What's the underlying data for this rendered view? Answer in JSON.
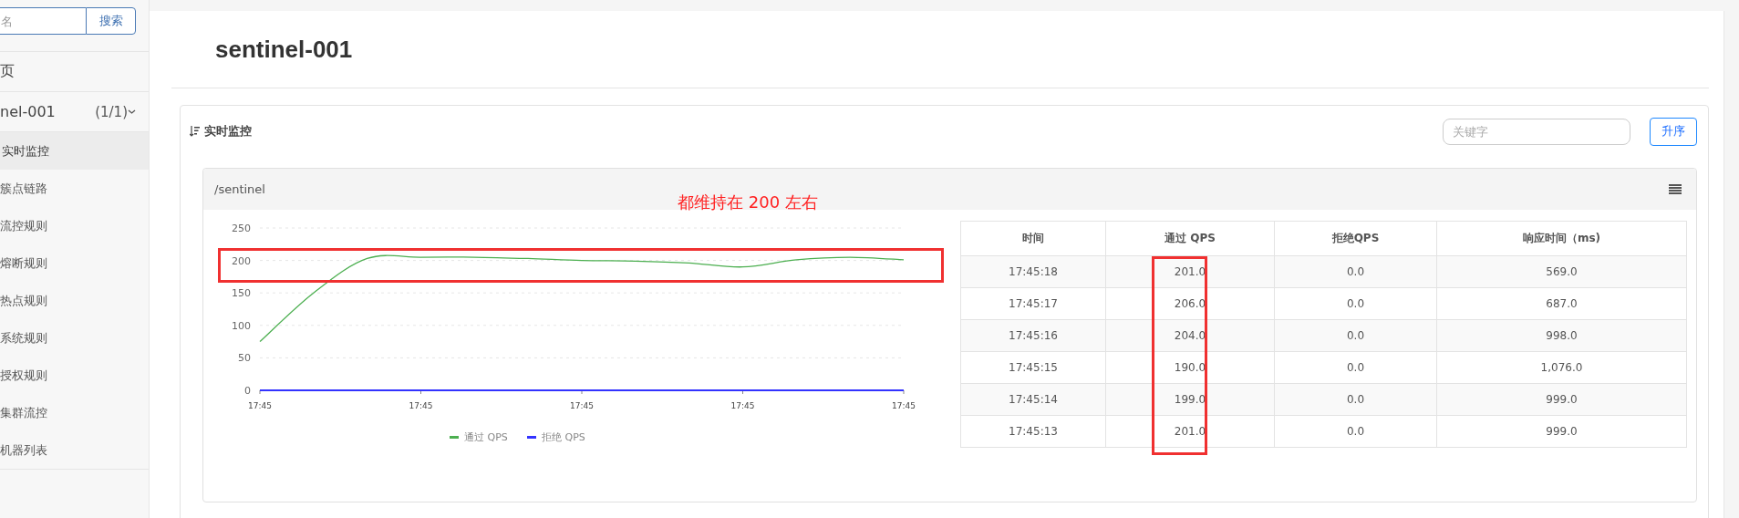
{
  "sidebar": {
    "search": {
      "placeholder": "名"
    },
    "search_button": "搜索",
    "items": [
      {
        "label": "页",
        "selected": false
      },
      {
        "label": "nel-001",
        "count": "(1/1)",
        "expanded": true,
        "selected": false,
        "children": [
          {
            "label": "实时监控",
            "selected": true
          },
          {
            "label": "簇点链路",
            "selected": false
          },
          {
            "label": "流控规则",
            "selected": false
          },
          {
            "label": "熔断规则",
            "selected": false
          },
          {
            "label": "热点规则",
            "selected": false
          },
          {
            "label": "系统规则",
            "selected": false
          },
          {
            "label": "授权规则",
            "selected": false
          },
          {
            "label": "集群流控",
            "selected": false
          },
          {
            "label": "机器列表",
            "selected": false
          }
        ]
      }
    ]
  },
  "page_title": "sentinel-001",
  "panel": {
    "title": "实时监控",
    "search": {
      "placeholder": "关键字"
    },
    "sort_button": "升序",
    "card": {
      "title": "/sentinel",
      "note": "都维持在 200 左右",
      "chart_marked": true,
      "chart_data": {
        "type": "line",
        "categories": [
          "17:45",
          null,
          null,
          "17:45",
          null,
          null,
          "17:45",
          null,
          null,
          "17:45",
          null,
          null,
          "17:45"
        ],
        "ylim": [
          0,
          250
        ],
        "grid": true,
        "legend": "bottom",
        "yticks": [
          0,
          50,
          100,
          150,
          200,
          250
        ],
        "series": [
          {
            "name": "通过 QPS",
            "color": "#4caf50",
            "values": [
              75,
              150,
              203,
              205,
              205,
              203,
              200,
              199,
              196,
              190,
              201,
              205,
              201
            ]
          },
          {
            "name": "拒绝 QPS",
            "color": "#3333ff",
            "values": [
              0,
              0,
              0,
              0,
              0,
              0,
              0,
              0,
              0,
              0,
              0,
              0,
              0
            ]
          }
        ]
      },
      "table": {
        "columns": [
          {
            "label": "时间",
            "highlighted": false
          },
          {
            "label": "通过 QPS",
            "highlighted": true
          },
          {
            "label": "拒绝QPS",
            "highlighted": false
          },
          {
            "label": "响应时间（ms)",
            "highlighted": false
          }
        ],
        "rows": [
          [
            "17:45:18",
            "201.0",
            "0.0",
            "569.0"
          ],
          [
            "17:45:17",
            "206.0",
            "0.0",
            "687.0"
          ],
          [
            "17:45:16",
            "204.0",
            "0.0",
            "998.0"
          ],
          [
            "17:45:15",
            "190.0",
            "0.0",
            "1,076.0"
          ],
          [
            "17:45:14",
            "199.0",
            "0.0",
            "999.0"
          ],
          [
            "17:45:13",
            "201.0",
            "0.0",
            "999.0"
          ]
        ]
      }
    }
  }
}
